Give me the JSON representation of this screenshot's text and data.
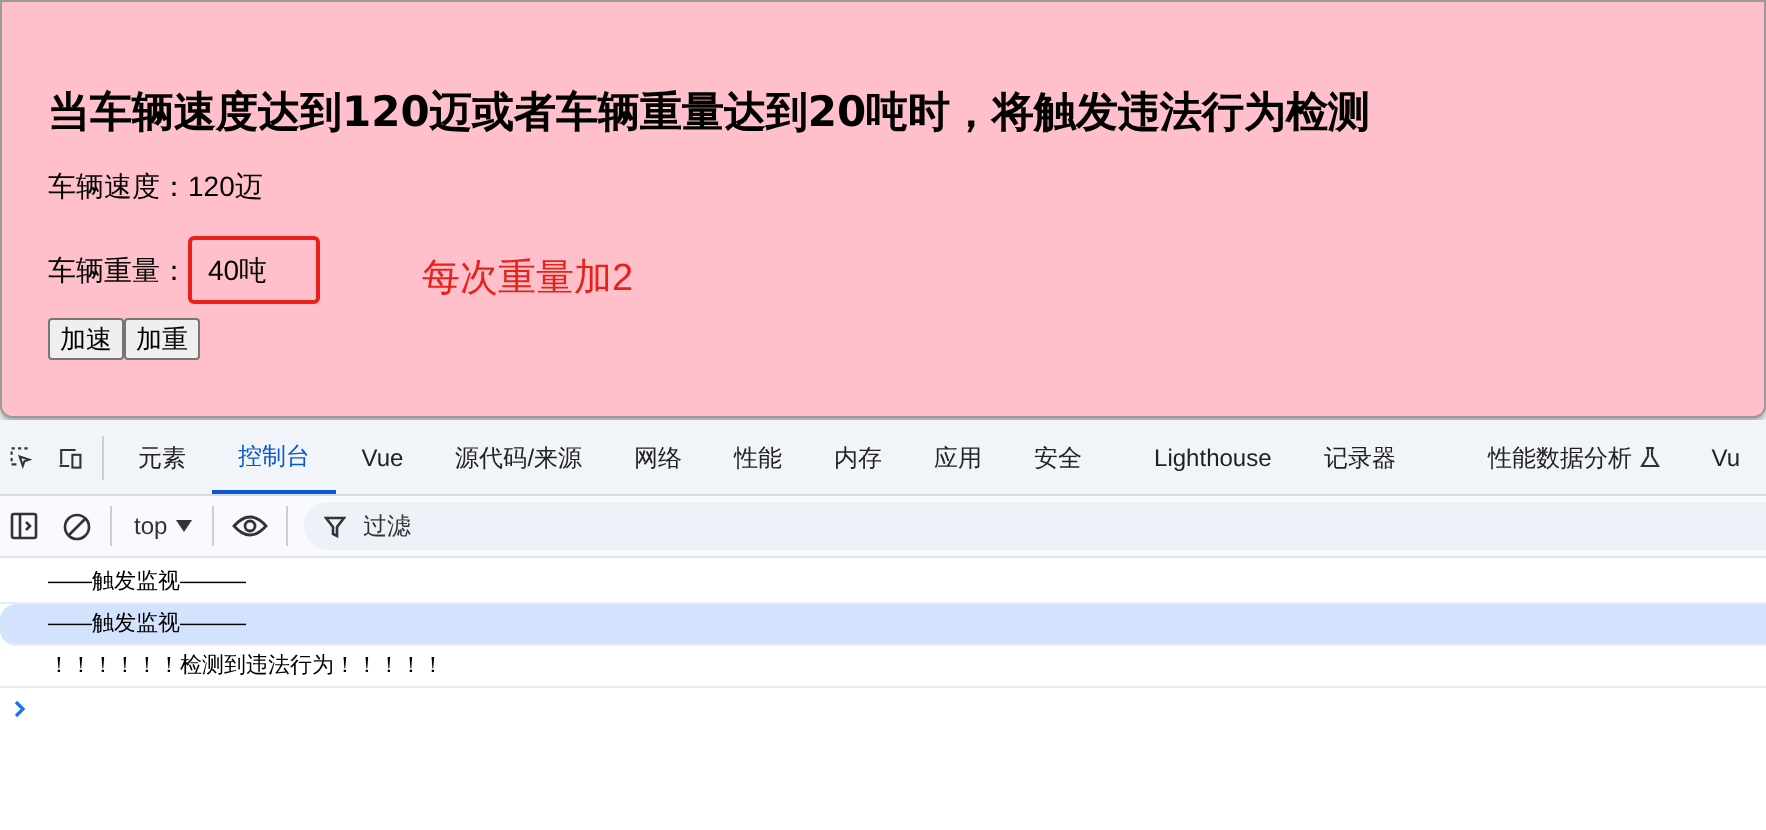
{
  "page": {
    "heading": "当车辆速度达到120迈或者车辆重量达到20吨时，将触发违法行为检测",
    "speed": {
      "label": "车辆速度：",
      "value": "120迈"
    },
    "weight": {
      "label": "车辆重量：",
      "value": "40吨",
      "highlighted": true
    },
    "annotation": "每次重量加2",
    "buttons": [
      "加速",
      "加重"
    ]
  },
  "devtools": {
    "tabs": [
      {
        "label": "元素",
        "selected": false
      },
      {
        "label": "控制台",
        "selected": true
      },
      {
        "label": "Vue",
        "selected": false
      },
      {
        "label": "源代码/来源",
        "selected": false
      },
      {
        "label": "网络",
        "selected": false
      },
      {
        "label": "性能",
        "selected": false
      },
      {
        "label": "内存",
        "selected": false
      },
      {
        "label": "应用",
        "selected": false
      },
      {
        "label": "安全",
        "selected": false
      },
      {
        "label": "Lighthouse",
        "selected": false
      },
      {
        "label": "记录器",
        "selected": false
      },
      {
        "label": "性能数据分析",
        "selected": false,
        "experimental": true
      },
      {
        "label": "Vu",
        "selected": false
      }
    ],
    "context": "top",
    "filter_placeholder": "过滤",
    "console": [
      {
        "text": "——触发监视———",
        "selected": false
      },
      {
        "text": "——触发监视———",
        "selected": true
      },
      {
        "text": "！！！！！！检测到违法行为！！！！！",
        "selected": false
      }
    ]
  }
}
